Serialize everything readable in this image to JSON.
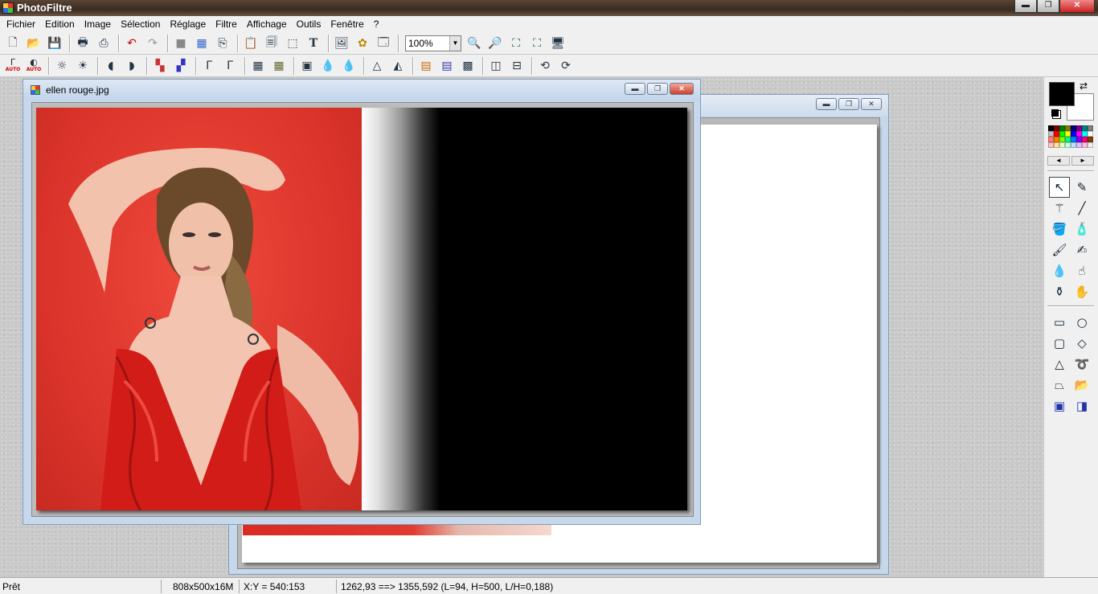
{
  "app": {
    "title": "PhotoFiltre"
  },
  "window_controls": {
    "minimize": "▬",
    "restore": "❐",
    "close": "✕"
  },
  "menu": [
    "Fichier",
    "Edition",
    "Image",
    "Sélection",
    "Réglage",
    "Filtre",
    "Affichage",
    "Outils",
    "Fenêtre",
    "?"
  ],
  "toolbar1": {
    "icons": [
      "new-icon",
      "open-icon",
      "save-icon",
      "print-icon",
      "scan-icon",
      "undo-icon",
      "redo-icon",
      "fill-gray-icon",
      "color-grid-icon",
      "copy-icon",
      "paste-icon",
      "paste-new-icon",
      "crop-select-icon",
      "text-icon",
      "image-mask-icon",
      "filter-cog-icon",
      "window-icon",
      "zoom-in-icon",
      "zoom-out-icon",
      "fit-image-icon",
      "actual-size-icon",
      "fullscreen-icon"
    ],
    "zoom_value": "100%"
  },
  "toolbar2": {
    "icons": [
      "auto-levels-icon",
      "auto-contrast-icon",
      "brightness-minus-icon",
      "brightness-plus-icon",
      "contrast-minus-icon",
      "contrast-plus-icon",
      "saturation-minus-icon",
      "saturation-plus-icon",
      "gamma-minus-icon",
      "gamma-plus-icon",
      "grayscale-icon",
      "sepia-icon",
      "mosaic-icon",
      "blur-icon",
      "sharpen-icon",
      "emboss-icon",
      "edge-icon",
      "color-balance-icon",
      "gradient-icon",
      "transparency-icon",
      "flip-horizontal-icon",
      "flip-vertical-icon",
      "rotate-left-icon",
      "rotate-right-icon"
    ]
  },
  "auto_labels": {
    "a1": "AUTO",
    "a2": "AUTO"
  },
  "documents": {
    "front": {
      "name": "ellen rouge.jpg"
    }
  },
  "colors": {
    "foreground": "#000000",
    "background": "#ffffff",
    "palette": [
      "#000000",
      "#800000",
      "#008000",
      "#808000",
      "#000080",
      "#800080",
      "#008080",
      "#808080",
      "#c0c0c0",
      "#ff0000",
      "#00ff00",
      "#ffff00",
      "#0000ff",
      "#ff00ff",
      "#00ffff",
      "#ffffff",
      "#ff8080",
      "#ff8000",
      "#80ff00",
      "#00ff80",
      "#0080ff",
      "#8000ff",
      "#ff0080",
      "#804000",
      "#ffc0c0",
      "#ffe0a0",
      "#e0ffc0",
      "#c0ffe0",
      "#c0e0ff",
      "#e0c0ff",
      "#ffc0e0",
      "#f0f0f0"
    ]
  },
  "palette_nav": {
    "prev": "◄",
    "next": "►"
  },
  "tools": {
    "group1": [
      "select-arrow-icon",
      "eyedropper-icon",
      "magic-wand-icon",
      "line-icon",
      "fill-bucket-icon",
      "spray-icon",
      "brush-icon",
      "advanced-brush-icon",
      "blur-drop-icon",
      "smudge-icon",
      "stamp-icon",
      "hand-icon"
    ],
    "group2": [
      "rectangle-icon",
      "ellipse-icon",
      "rounded-rect-icon",
      "diamond-icon",
      "triangle-icon",
      "lasso-icon",
      "polygon-lasso-icon",
      "open-folder-icon",
      "select-all-icon",
      "select-invert-icon"
    ]
  },
  "status": {
    "state": "Prêt",
    "image_info": "808x500x16M",
    "coords": "X:Y = 540:153",
    "selection": "1262,93 ==> 1355,592 (L=94, H=500, L/H=0,188)"
  }
}
